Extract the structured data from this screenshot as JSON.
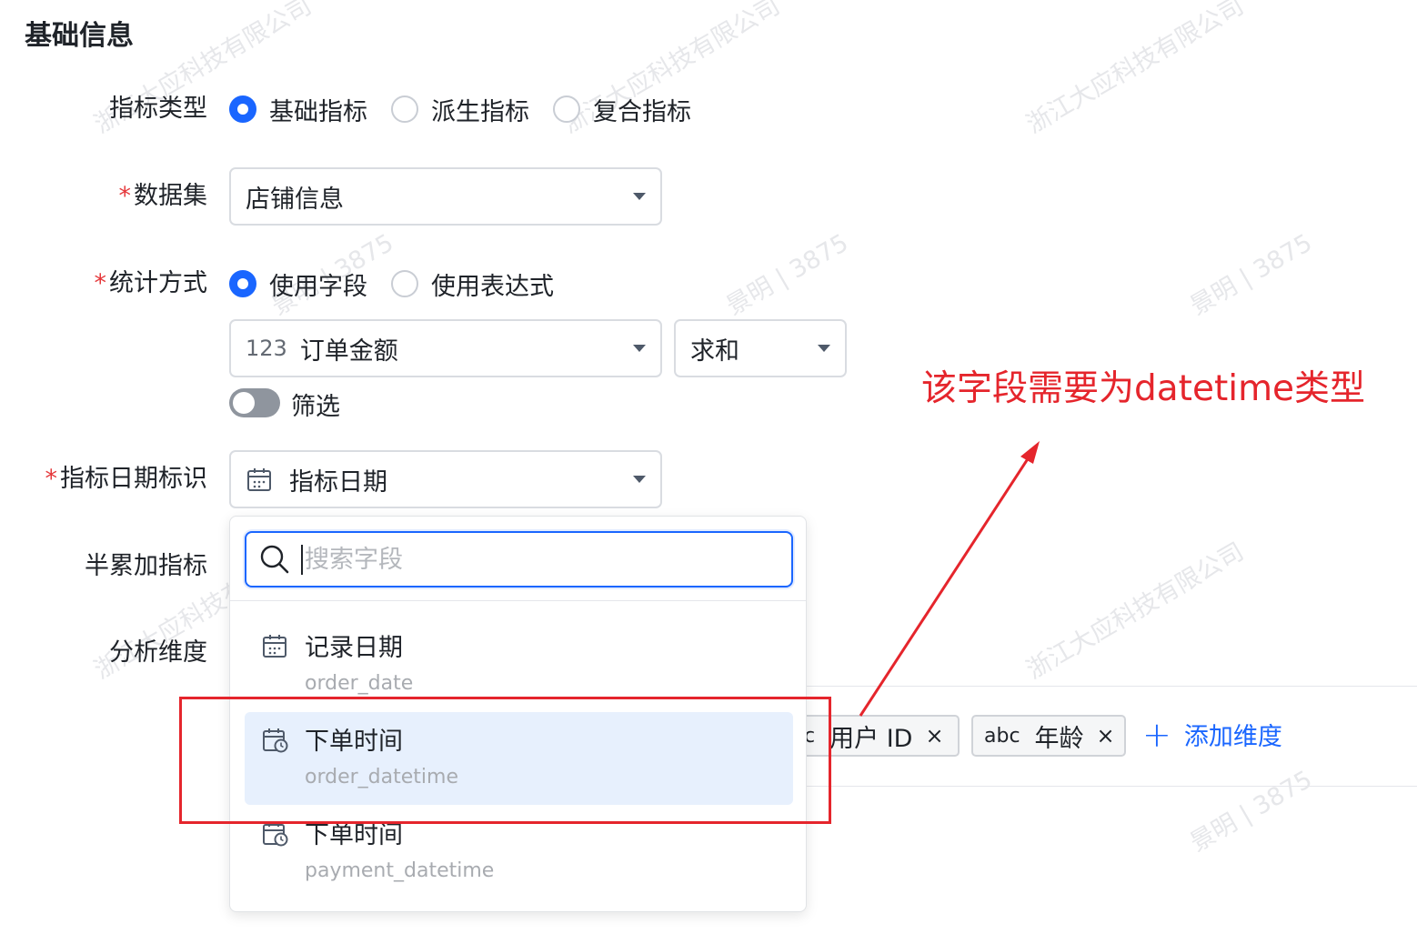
{
  "section_title": "基础信息",
  "fields": {
    "metric_type": {
      "label": "指标类型",
      "options": [
        "基础指标",
        "派生指标",
        "复合指标"
      ],
      "selected": "基础指标"
    },
    "dataset": {
      "required_mark": "*",
      "label": "数据集",
      "value": "店铺信息"
    },
    "stat_method": {
      "required_mark": "*",
      "label": "统计方式",
      "options": [
        "使用字段",
        "使用表达式"
      ],
      "selected": "使用字段",
      "field_type_badge": "123",
      "field_value": "订单金额",
      "aggregation_value": "求和",
      "filter_label": "筛选"
    },
    "date_identifier": {
      "required_mark": "*",
      "label": "指标日期标识",
      "value": "指标日期"
    },
    "semi_additive": {
      "label": "半累加指标"
    },
    "dimensions": {
      "label": "分析维度",
      "chips": [
        {
          "type_badge": "c",
          "name": "用户 ID",
          "remove": "×"
        },
        {
          "type_badge": "abc",
          "name": "年龄",
          "remove": "×"
        }
      ],
      "add_label": "添加维度"
    }
  },
  "dropdown": {
    "search_placeholder": "搜索字段",
    "options": [
      {
        "name": "记录日期",
        "field": "order_date",
        "icon": "calendar-icon",
        "selected": false
      },
      {
        "name": "下单时间",
        "field": "order_datetime",
        "icon": "calendar-clock-icon",
        "selected": true
      },
      {
        "name": "下单时间",
        "field": "payment_datetime",
        "icon": "calendar-clock-icon",
        "selected": false
      }
    ]
  },
  "annotation": {
    "note": "该字段需要为datetime类型",
    "color": "#e5252c"
  },
  "watermarks": [
    "浙江大应科技有限公司",
    "景明 | 3875"
  ],
  "colors": {
    "primary": "#1a66ff",
    "required": "#e5383b",
    "selected_bg": "#e7f0fd"
  }
}
